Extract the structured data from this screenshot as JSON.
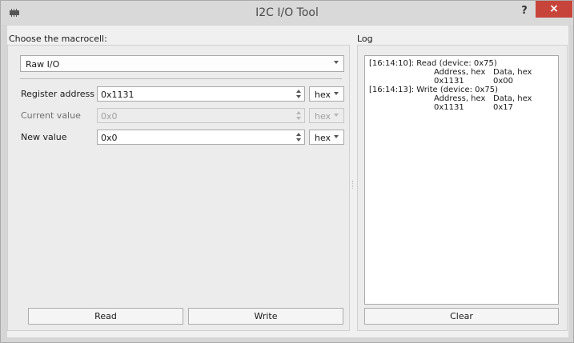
{
  "window": {
    "title": "I2C I/O Tool",
    "help_label": "?",
    "close_label": "×"
  },
  "macrocell": {
    "label": "Choose the macrocell:",
    "selected": "Raw I/O"
  },
  "fields": {
    "register_address": {
      "label": "Register address",
      "value": "0x1131",
      "base": "hex"
    },
    "current_value": {
      "label": "Current value",
      "value": "0x0",
      "base": "hex"
    },
    "new_value": {
      "label": "New value",
      "value": "0x0",
      "base": "hex"
    }
  },
  "buttons": {
    "read": "Read",
    "write": "Write",
    "clear": "Clear"
  },
  "log": {
    "label": "Log",
    "entries": [
      {
        "head": "[16:14:10]: Read (device: 0x75)",
        "col1_header": "Address, hex",
        "col2_header": "Data, hex",
        "col1_value": "0x1131",
        "col2_value": "0x00"
      },
      {
        "head": "[16:14:13]: Write (device: 0x75)",
        "col1_header": "Address, hex",
        "col2_header": "Data, hex",
        "col1_value": "0x1131",
        "col2_value": "0x17"
      }
    ]
  },
  "colors": {
    "close_button": "#c7443a",
    "titlebar": "#d9d9d9",
    "client_background": "#f0f0f0"
  },
  "icons": [
    "app-icon",
    "help-icon",
    "close-icon",
    "chevron-down-icon",
    "spin-up-icon",
    "spin-down-icon"
  ]
}
